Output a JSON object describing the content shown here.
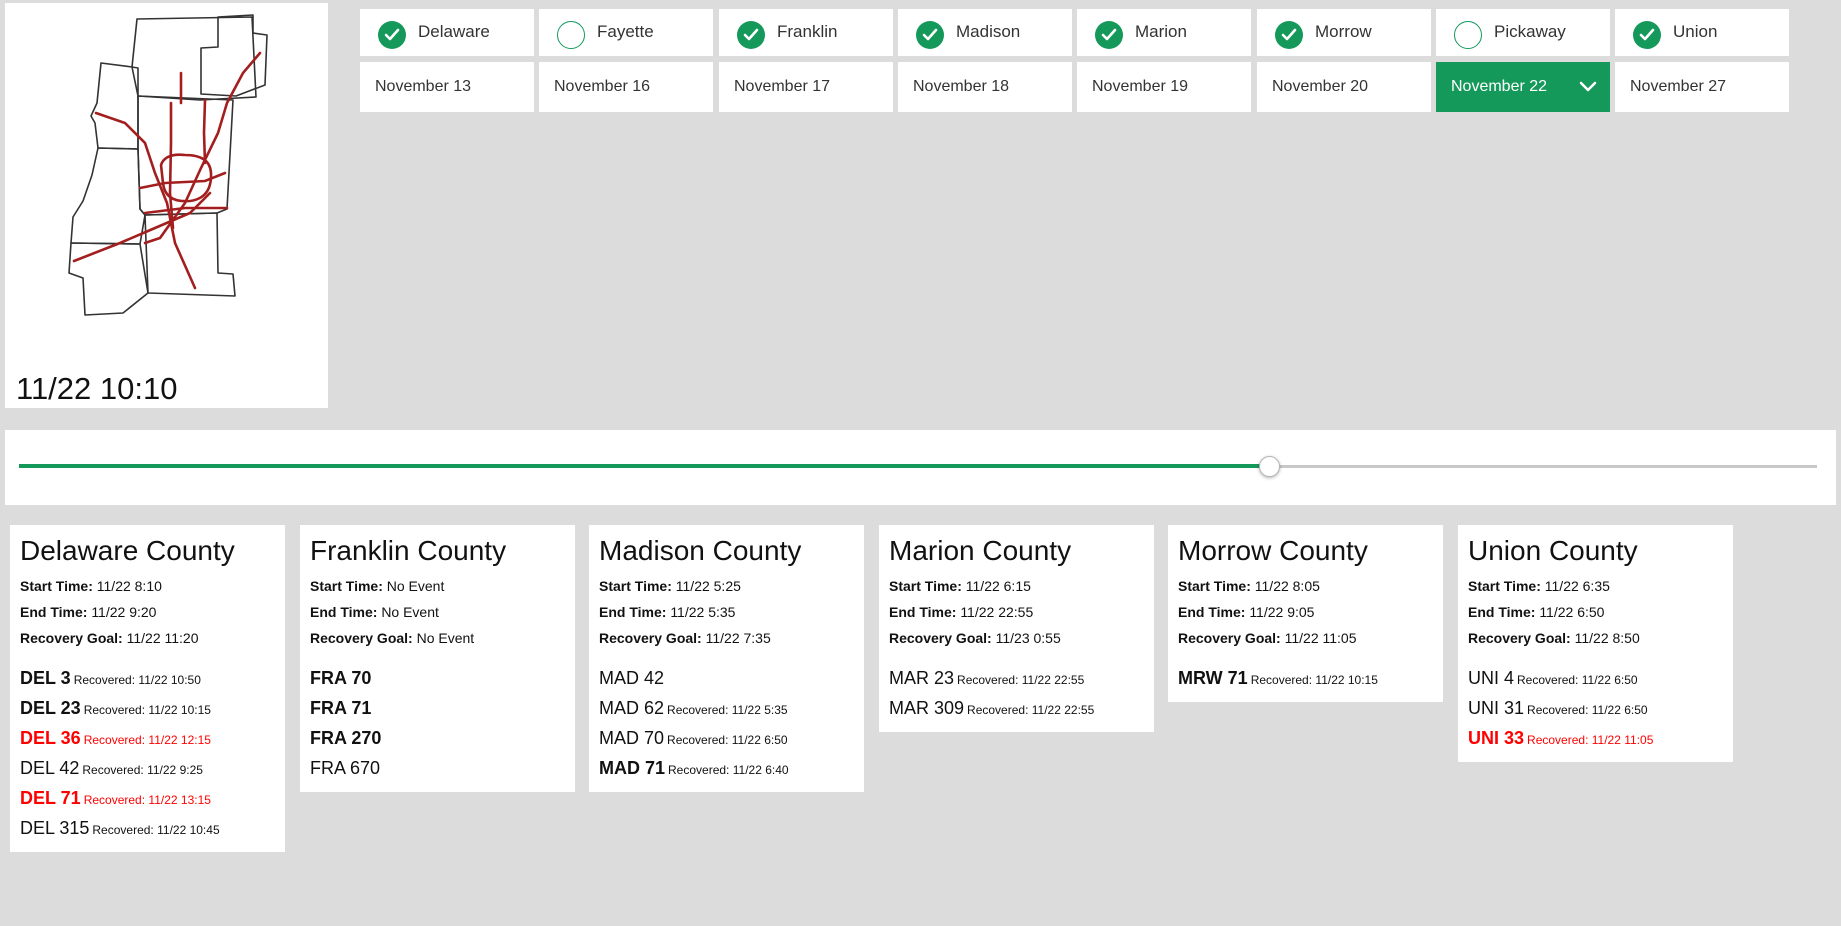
{
  "map": {
    "timestamp": "11/22 10:10"
  },
  "counties": [
    {
      "label": "Delaware",
      "checked": true
    },
    {
      "label": "Fayette",
      "checked": false
    },
    {
      "label": "Franklin",
      "checked": true
    },
    {
      "label": "Madison",
      "checked": true
    },
    {
      "label": "Marion",
      "checked": true
    },
    {
      "label": "Morrow",
      "checked": true
    },
    {
      "label": "Pickaway",
      "checked": false
    },
    {
      "label": "Union",
      "checked": true
    }
  ],
  "dates": [
    {
      "label": "November 13",
      "active": false
    },
    {
      "label": "November 16",
      "active": false
    },
    {
      "label": "November 17",
      "active": false
    },
    {
      "label": "November 18",
      "active": false
    },
    {
      "label": "November 19",
      "active": false
    },
    {
      "label": "November 20",
      "active": false
    },
    {
      "label": "November 22",
      "active": true
    },
    {
      "label": "November 27",
      "active": false
    }
  ],
  "slider": {
    "value_fraction": 0.695
  },
  "labels": {
    "start": "Start Time:",
    "end": "End Time:",
    "goal": "Recovery Goal:",
    "recovered": "Recovered:"
  },
  "colors": {
    "accent": "#15995a",
    "alert": "#ff0000"
  },
  "cards": [
    {
      "title": "Delaware County",
      "start": "11/22 8:10",
      "end": "11/22 9:20",
      "goal": "11/22 11:20",
      "routes": [
        {
          "code": "DEL 3",
          "bold": true,
          "red": false,
          "recovered": "11/22 10:50"
        },
        {
          "code": "DEL 23",
          "bold": true,
          "red": false,
          "recovered": "11/22 10:15"
        },
        {
          "code": "DEL 36",
          "bold": true,
          "red": true,
          "recovered": "11/22 12:15"
        },
        {
          "code": "DEL 42",
          "bold": false,
          "red": false,
          "recovered": "11/22 9:25"
        },
        {
          "code": "DEL 71",
          "bold": true,
          "red": true,
          "recovered": "11/22 13:15"
        },
        {
          "code": "DEL 315",
          "bold": false,
          "red": false,
          "recovered": "11/22 10:45"
        }
      ]
    },
    {
      "title": "Franklin County",
      "start": "No Event",
      "end": "No Event",
      "goal": "No Event",
      "routes": [
        {
          "code": "FRA 70",
          "bold": true,
          "red": false,
          "recovered": null
        },
        {
          "code": "FRA 71",
          "bold": true,
          "red": false,
          "recovered": null
        },
        {
          "code": "FRA 270",
          "bold": true,
          "red": false,
          "recovered": null
        },
        {
          "code": "FRA 670",
          "bold": false,
          "red": false,
          "recovered": null
        }
      ]
    },
    {
      "title": "Madison County",
      "start": "11/22 5:25",
      "end": "11/22 5:35",
      "goal": "11/22 7:35",
      "routes": [
        {
          "code": "MAD 42",
          "bold": false,
          "red": false,
          "recovered": null
        },
        {
          "code": "MAD 62",
          "bold": false,
          "red": false,
          "recovered": "11/22 5:35"
        },
        {
          "code": "MAD 70",
          "bold": false,
          "red": false,
          "recovered": "11/22 6:50"
        },
        {
          "code": "MAD 71",
          "bold": true,
          "red": false,
          "recovered": "11/22 6:40"
        }
      ]
    },
    {
      "title": "Marion County",
      "start": "11/22 6:15",
      "end": "11/22 22:55",
      "goal": "11/23 0:55",
      "routes": [
        {
          "code": "MAR 23",
          "bold": false,
          "red": false,
          "recovered": "11/22 22:55"
        },
        {
          "code": "MAR 309",
          "bold": false,
          "red": false,
          "recovered": "11/22 22:55"
        }
      ]
    },
    {
      "title": "Morrow County",
      "start": "11/22 8:05",
      "end": "11/22 9:05",
      "goal": "11/22 11:05",
      "routes": [
        {
          "code": "MRW 71",
          "bold": true,
          "red": false,
          "recovered": "11/22 10:15"
        }
      ]
    },
    {
      "title": "Union County",
      "start": "11/22 6:35",
      "end": "11/22 6:50",
      "goal": "11/22 8:50",
      "routes": [
        {
          "code": "UNI 4",
          "bold": false,
          "red": false,
          "recovered": "11/22 6:50"
        },
        {
          "code": "UNI 31",
          "bold": false,
          "red": false,
          "recovered": "11/22 6:50"
        },
        {
          "code": "UNI 33",
          "bold": true,
          "red": true,
          "recovered": "11/22 11:05"
        }
      ]
    }
  ]
}
